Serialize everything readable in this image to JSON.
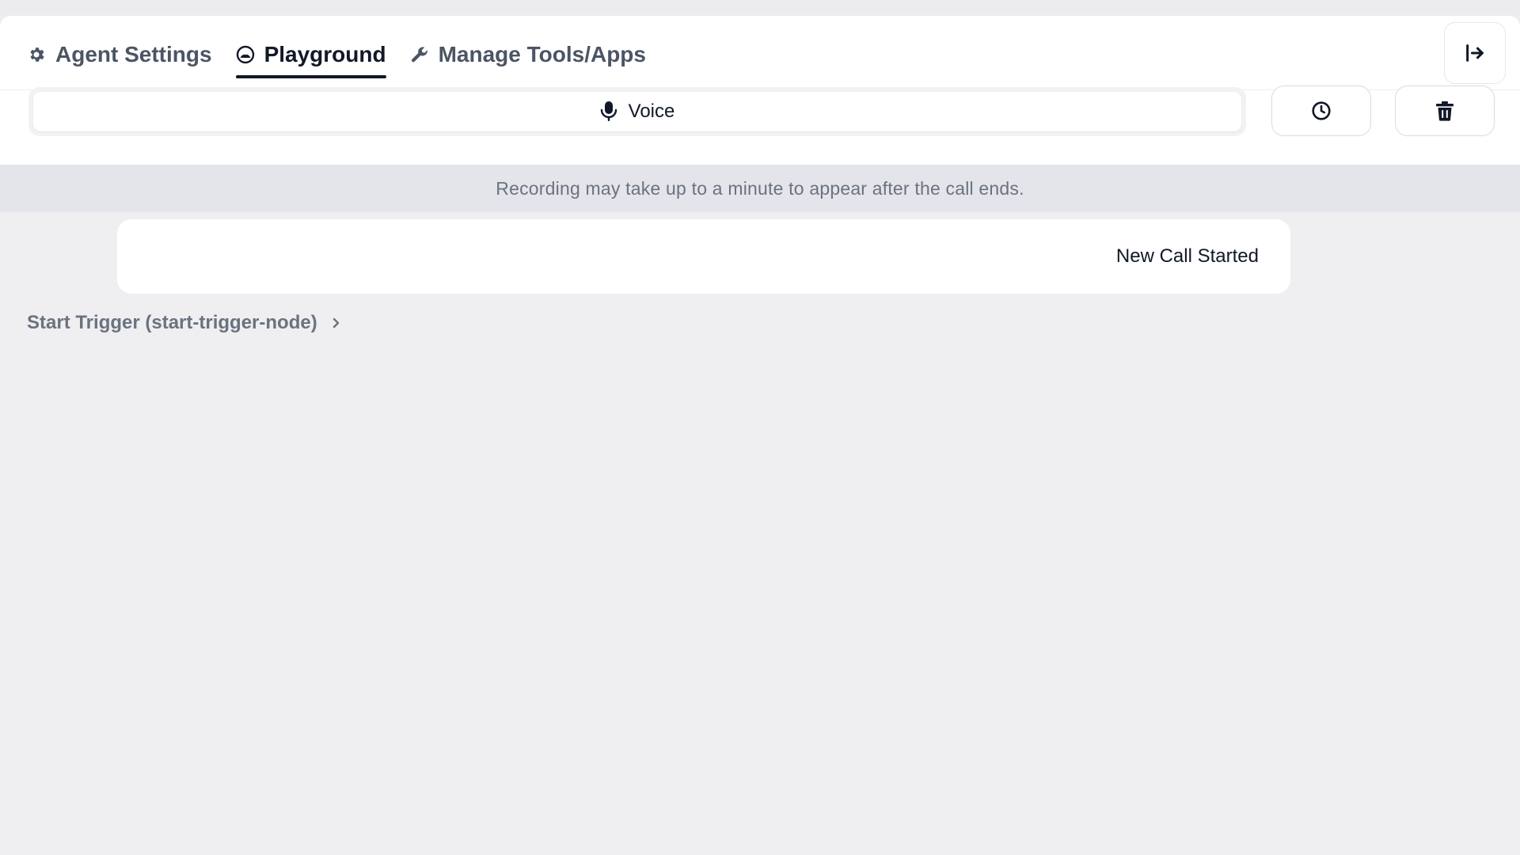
{
  "tabs": [
    {
      "label": "Agent Settings",
      "icon": "gear-icon",
      "active": false
    },
    {
      "label": "Playground",
      "icon": "playground-icon",
      "active": true
    },
    {
      "label": "Manage Tools/Apps",
      "icon": "wrench-icon",
      "active": false
    }
  ],
  "toolbar": {
    "voice_label": "Voice",
    "voice_icon": "microphone-icon",
    "history_icon": "clock-icon",
    "delete_icon": "trash-icon",
    "collapse_icon": "collapse-panel-icon"
  },
  "notice": {
    "text": "Recording may take up to a minute to appear after the call ends."
  },
  "conversation": {
    "event_text": "New Call Started",
    "trigger_label": "Start Trigger (start-trigger-node)",
    "trigger_icon": "chevron-right-icon"
  },
  "colors": {
    "background": "#efeff1",
    "panel": "#ffffff",
    "text_primary": "#111827",
    "text_muted": "#6b7280",
    "notice_bg": "#e3e5ea"
  }
}
